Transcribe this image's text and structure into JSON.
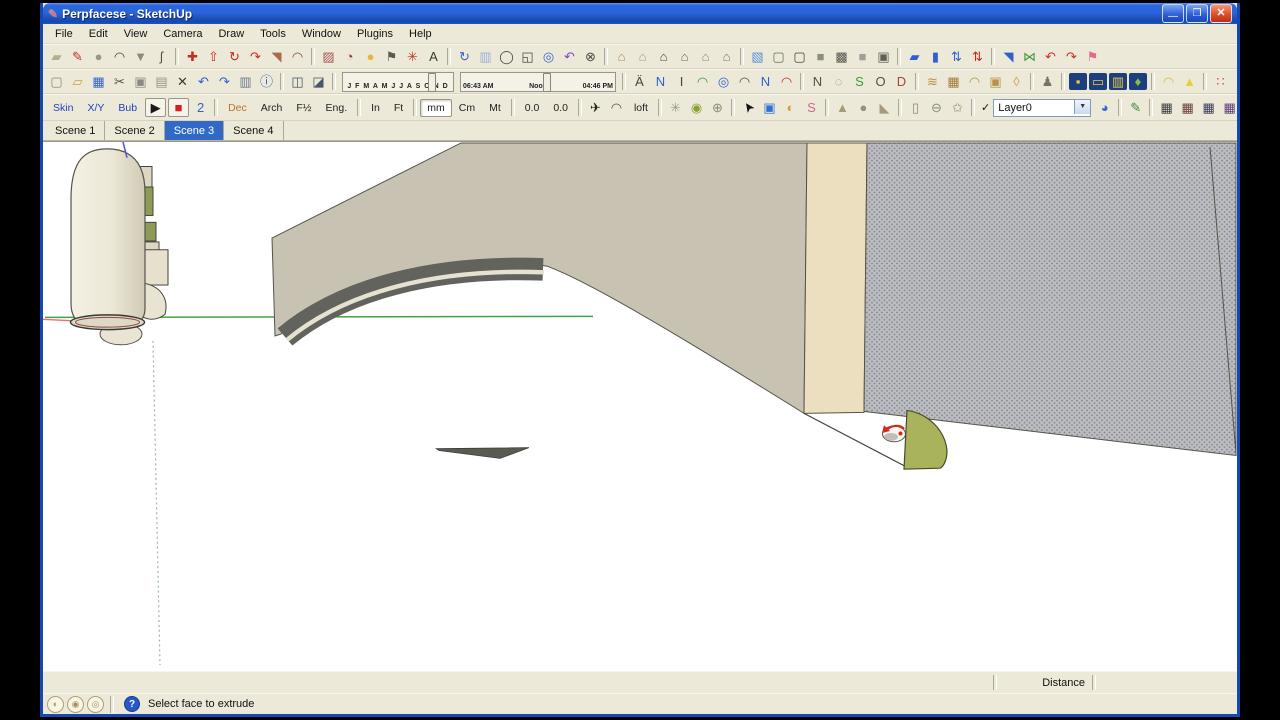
{
  "window": {
    "title": "Perpfacese - SketchUp",
    "icon_glyph": "✎",
    "glyph_min": "—",
    "glyph_restore": "❒",
    "glyph_close": "✕"
  },
  "menu": {
    "items": [
      "File",
      "Edit",
      "View",
      "Camera",
      "Draw",
      "Tools",
      "Window",
      "Plugins",
      "Help"
    ]
  },
  "colors": {
    "titlebar_blue": "#2b63d8",
    "toolbar_bg": "#ece9d8",
    "active_tab_blue": "#316ac5",
    "model_taupe": "#c7c2b2",
    "model_dark_band": "#63635d",
    "wall_tan": "#ecdfc0",
    "wall_texture_bg": "#bcbdc1",
    "wall_texture_dot": "#83858f",
    "capsule_cream": "#efebdc",
    "panel_olive": "#8e9a55",
    "fan_green": "#a9b35c",
    "axis_green": "#44a244",
    "axis_red": "#e87272",
    "axis_blue": "#5050d8",
    "sliver_dark": "#5a5a52",
    "viewport_white": "#ffffff"
  },
  "toolbar_row1": {
    "items": [
      {
        "t": "i",
        "n": "rectangle-tool",
        "g": "▰",
        "c": "#b5ad92"
      },
      {
        "t": "i",
        "n": "line-tool",
        "g": "✎",
        "c": "#c23125"
      },
      {
        "t": "i",
        "n": "circle-tool",
        "g": "●",
        "c": "#9b9685"
      },
      {
        "t": "i",
        "n": "arc-tool",
        "g": "◠",
        "c": "#4a4a44"
      },
      {
        "t": "i",
        "n": "polygon-tool",
        "g": "▼",
        "c": "#8f8a78"
      },
      {
        "t": "i",
        "n": "freehand-tool",
        "g": "ʃ",
        "c": "#55504a"
      },
      {
        "t": "s"
      },
      {
        "t": "i",
        "n": "move-tool",
        "g": "✚",
        "c": "#c8281e"
      },
      {
        "t": "i",
        "n": "pushpull-tool",
        "g": "⇧",
        "c": "#c8281e"
      },
      {
        "t": "i",
        "n": "rotate-tool",
        "g": "↻",
        "c": "#c8281e"
      },
      {
        "t": "i",
        "n": "followme-tool",
        "g": "↷",
        "c": "#c8281e"
      },
      {
        "t": "i",
        "n": "scale-tool",
        "g": "◥",
        "c": "#a86a48"
      },
      {
        "t": "i",
        "n": "offset-tool",
        "g": "◠",
        "c": "#8a4a3a"
      },
      {
        "t": "s"
      },
      {
        "t": "i",
        "n": "tape-measure-tool",
        "g": "▨",
        "c": "#a85858"
      },
      {
        "t": "i",
        "n": "protractor-tool",
        "g": "◔",
        "c": "#8a3a30"
      },
      {
        "t": "i",
        "n": "paint-bucket-tool",
        "g": "●",
        "c": "#e2b93a"
      },
      {
        "t": "i",
        "n": "text-tool",
        "g": "⚑",
        "c": "#5a5a52"
      },
      {
        "t": "i",
        "n": "axes-tool",
        "g": "✳",
        "c": "#c23125"
      },
      {
        "t": "i",
        "n": "3d-text-tool",
        "g": "A",
        "c": "#3a3a34"
      },
      {
        "t": "s"
      },
      {
        "t": "i",
        "n": "orbit-tool",
        "g": "↻",
        "c": "#3565cf"
      },
      {
        "t": "i",
        "n": "pan-tool",
        "g": "▥",
        "c": "#9bb0d8"
      },
      {
        "t": "i",
        "n": "zoom-tool",
        "g": "◯",
        "c": "#4a4a44"
      },
      {
        "t": "i",
        "n": "zoom-window-tool",
        "g": "◱",
        "c": "#4a4a44"
      },
      {
        "t": "i",
        "n": "zoom-extents-tool",
        "g": "◎",
        "c": "#3565cf"
      },
      {
        "t": "i",
        "n": "zoom-previous-tool",
        "g": "↶",
        "c": "#7a4ac0"
      },
      {
        "t": "i",
        "n": "zoom-photo-tool",
        "g": "⊗",
        "c": "#4a4a44"
      },
      {
        "t": "s"
      },
      {
        "t": "i",
        "n": "view-iso",
        "g": "⌂",
        "c": "#b5884a"
      },
      {
        "t": "i",
        "n": "view-top",
        "g": "⌂",
        "c": "#a89a78"
      },
      {
        "t": "i",
        "n": "view-front",
        "g": "⌂",
        "c": "#4a4a44"
      },
      {
        "t": "i",
        "n": "view-back",
        "g": "⌂",
        "c": "#6a6a60"
      },
      {
        "t": "i",
        "n": "view-left",
        "g": "⌂",
        "c": "#8a8a80"
      },
      {
        "t": "i",
        "n": "view-right",
        "g": "⌂",
        "c": "#7a7a70"
      },
      {
        "t": "s"
      },
      {
        "t": "i",
        "n": "style-xray",
        "g": "▧",
        "c": "#5a93d8"
      },
      {
        "t": "i",
        "n": "style-wireframe",
        "g": "▢",
        "c": "#6a6a60"
      },
      {
        "t": "i",
        "n": "style-hidden-line",
        "g": "▢",
        "c": "#44443e"
      },
      {
        "t": "i",
        "n": "style-shaded",
        "g": "■",
        "c": "#8c8c80"
      },
      {
        "t": "i",
        "n": "style-textured",
        "g": "▩",
        "c": "#55554e"
      },
      {
        "t": "i",
        "n": "style-monochrome",
        "g": "■",
        "c": "#a0a098"
      },
      {
        "t": "i",
        "n": "style-back-edges",
        "g": "▣",
        "c": "#5f5f58"
      },
      {
        "t": "s"
      },
      {
        "t": "i",
        "n": "perp-face-tool-1",
        "g": "▰",
        "c": "#2f5fd0"
      },
      {
        "t": "i",
        "n": "perp-face-tool-2",
        "g": "▮",
        "c": "#2f5fd0"
      },
      {
        "t": "i",
        "n": "perp-updown-tool-1",
        "g": "⇅",
        "c": "#2f5fd0"
      },
      {
        "t": "i",
        "n": "perp-updown-tool-2",
        "g": "⇅",
        "c": "#c8281e"
      },
      {
        "t": "s"
      },
      {
        "t": "i",
        "n": "diagonal-tool",
        "g": "◥",
        "c": "#2f5fd0"
      },
      {
        "t": "i",
        "n": "section-x-tool",
        "g": "⋈",
        "c": "#3a9a3a"
      },
      {
        "t": "i",
        "n": "curve-undo-tool",
        "g": "↶",
        "c": "#c23125"
      },
      {
        "t": "i",
        "n": "curve-redo-tool",
        "g": "↷",
        "c": "#c23125"
      },
      {
        "t": "i",
        "n": "flag-tool",
        "g": "⚑",
        "c": "#e06a8a"
      }
    ]
  },
  "toolbar_row2": {
    "items": [
      {
        "t": "i",
        "n": "new-file",
        "g": "▢",
        "c": "#8a8a80"
      },
      {
        "t": "i",
        "n": "open-file",
        "g": "▱",
        "c": "#c8a14a"
      },
      {
        "t": "i",
        "n": "save-file",
        "g": "▦",
        "c": "#2f5fd0"
      },
      {
        "t": "i",
        "n": "cut",
        "g": "✂",
        "c": "#55504a"
      },
      {
        "t": "i",
        "n": "copy",
        "g": "▣",
        "c": "#8a8a80"
      },
      {
        "t": "i",
        "n": "paste",
        "g": "▤",
        "c": "#9a9284"
      },
      {
        "t": "i",
        "n": "erase",
        "g": "✕",
        "c": "#3a3a34"
      },
      {
        "t": "i",
        "n": "undo",
        "g": "↶",
        "c": "#2f5fd0"
      },
      {
        "t": "i",
        "n": "redo",
        "g": "↷",
        "c": "#2f5fd0"
      },
      {
        "t": "i",
        "n": "print",
        "g": "▥",
        "c": "#6a7a8a"
      },
      {
        "t": "i",
        "n": "model-info",
        "g": "ⓘ",
        "c": "#2858c8"
      },
      {
        "t": "s"
      },
      {
        "t": "i",
        "n": "make-component",
        "g": "◫",
        "c": "#4a5568"
      },
      {
        "t": "i",
        "n": "component-cube",
        "g": "◪",
        "c": "#4a5568"
      },
      {
        "t": "s"
      },
      {
        "t": "months"
      },
      {
        "t": "time"
      },
      {
        "t": "s"
      },
      {
        "t": "i",
        "n": "bezier-curve-tool",
        "g": "Ä",
        "c": "#44443e"
      },
      {
        "t": "i",
        "n": "curve-n-tool",
        "g": "N",
        "c": "#2f5fd0"
      },
      {
        "t": "i",
        "n": "curve-i-tool",
        "g": "I",
        "c": "#44443e"
      },
      {
        "t": "i",
        "n": "arc-green-tool",
        "g": "◠",
        "c": "#3a9a3a"
      },
      {
        "t": "i",
        "n": "spiral-tool",
        "g": "◎",
        "c": "#2f5fd0"
      },
      {
        "t": "i",
        "n": "arc-dark-tool",
        "g": "◠",
        "c": "#55504a"
      },
      {
        "t": "i",
        "n": "curve-n2-tool",
        "g": "N",
        "c": "#2f5fd0"
      },
      {
        "t": "i",
        "n": "arc-red-tool",
        "g": "◠",
        "c": "#c23125"
      },
      {
        "t": "s"
      },
      {
        "t": "i",
        "n": "polyline-tool",
        "g": "N",
        "c": "#55504a"
      },
      {
        "t": "i",
        "n": "dashed-circle-tool",
        "g": "◌",
        "c": "#8a8a80"
      },
      {
        "t": "i",
        "n": "wrench-tool",
        "g": "S",
        "c": "#3a9a3a"
      },
      {
        "t": "i",
        "n": "circle-o-tool",
        "g": "O",
        "c": "#55504a"
      },
      {
        "t": "i",
        "n": "d-shape-tool",
        "g": "D",
        "c": "#a04a3a"
      },
      {
        "t": "s"
      },
      {
        "t": "i",
        "n": "sandbox-from-contours",
        "g": "≋",
        "c": "#b8914a"
      },
      {
        "t": "i",
        "n": "sandbox-from-scratch",
        "g": "▦",
        "c": "#a07a3a"
      },
      {
        "t": "i",
        "n": "smoove-tool",
        "g": "◠",
        "c": "#b8914a"
      },
      {
        "t": "i",
        "n": "stamp-tool",
        "g": "▣",
        "c": "#b8914a"
      },
      {
        "t": "i",
        "n": "drape-tool",
        "g": "◊",
        "c": "#c8a14a"
      },
      {
        "t": "s"
      },
      {
        "t": "i",
        "n": "person-figure",
        "g": "♟",
        "c": "#7a7468"
      },
      {
        "t": "s"
      },
      {
        "t": "i",
        "n": "film-stage-1",
        "g": "▪",
        "c": "#f0c83a",
        "bg": "#1d3f7e"
      },
      {
        "t": "i",
        "n": "film-stage-2",
        "g": "▭",
        "c": "#f0c83a",
        "bg": "#1d3f7e"
      },
      {
        "t": "i",
        "n": "film-stage-3",
        "g": "▥",
        "c": "#f0c83a",
        "bg": "#1d3f7e"
      },
      {
        "t": "i",
        "n": "film-stage-4",
        "g": "♦",
        "c": "#8ac040",
        "bg": "#1d3f7e"
      },
      {
        "t": "s"
      },
      {
        "t": "i",
        "n": "dome-tool",
        "g": "◠",
        "c": "#e2b93a"
      },
      {
        "t": "i",
        "n": "cone-tool",
        "g": "▲",
        "c": "#e2d23a"
      },
      {
        "t": "s"
      },
      {
        "t": "i",
        "n": "palette-dots-1",
        "g": "∷",
        "c": "#c04a8a"
      },
      {
        "t": "i",
        "n": "palette-dots-2",
        "g": "∷",
        "c": "#3a9ac0"
      }
    ]
  },
  "shadows": {
    "months_labels": "J F M A M J J A S O N D",
    "months_thumb_pct": 77,
    "time_start": "06:43 AM",
    "time_noon": "Noon",
    "time_end": "04:46 PM",
    "time_thumb_pct": 53
  },
  "toolbar_row3": {
    "items": [
      {
        "t": "b",
        "n": "skin-tool",
        "l": "Skin",
        "c": "#2040c0"
      },
      {
        "t": "b",
        "n": "xy-tool",
        "l": "X/Y",
        "c": "#2040c0"
      },
      {
        "t": "b",
        "n": "bubble-tool",
        "l": "Bub",
        "c": "#2040c0"
      },
      {
        "t": "i",
        "n": "play-button",
        "g": "▶",
        "c": "#1a1a1a",
        "box": true
      },
      {
        "t": "i",
        "n": "record-stop-button",
        "g": "■",
        "c": "#d42020",
        "box": true
      },
      {
        "t": "i",
        "n": "curl-tool",
        "g": "2",
        "c": "#2f5fd0"
      },
      {
        "t": "s"
      },
      {
        "t": "b",
        "n": "format-decimal-button",
        "l": "Dec",
        "c": "#b8742a"
      },
      {
        "t": "b",
        "n": "format-architectural-button",
        "l": "Arch"
      },
      {
        "t": "b",
        "n": "format-fractional-button",
        "l": "F½"
      },
      {
        "t": "b",
        "n": "format-engineering-button",
        "l": "Eng."
      },
      {
        "t": "s"
      },
      {
        "t": "b",
        "n": "unit-inches-button",
        "l": "In"
      },
      {
        "t": "b",
        "n": "unit-feet-button",
        "l": "Ft"
      },
      {
        "t": "s"
      },
      {
        "t": "b",
        "n": "unit-mm-button",
        "l": "mm",
        "p": true
      },
      {
        "t": "b",
        "n": "unit-cm-button",
        "l": "Cm"
      },
      {
        "t": "b",
        "n": "unit-meters-button",
        "l": "Mt"
      },
      {
        "t": "s"
      },
      {
        "t": "b",
        "n": "precision-decrease-button",
        "l": "0.0"
      },
      {
        "t": "b",
        "n": "precision-increase-button",
        "l": "0.0"
      },
      {
        "t": "s"
      },
      {
        "t": "i",
        "n": "plane-tool",
        "g": "✈",
        "c": "#22221e"
      },
      {
        "t": "i",
        "n": "flatten-arc-tool",
        "g": "◠",
        "c": "#55504a"
      },
      {
        "t": "b",
        "n": "loft-button",
        "l": "loft"
      },
      {
        "t": "s"
      },
      {
        "t": "i",
        "n": "shell-web-tool",
        "g": "✳",
        "c": "#9a9a92"
      },
      {
        "t": "i",
        "n": "lock-tool",
        "g": "◉",
        "c": "#8aa030"
      },
      {
        "t": "i",
        "n": "wire-sphere-tool",
        "g": "⊕",
        "c": "#8a8a80"
      },
      {
        "t": "s"
      },
      {
        "t": "i",
        "n": "select-cursor-tool",
        "g": "➤",
        "c": "#111111",
        "r": "rot-nw"
      },
      {
        "t": "i",
        "n": "soap-skin-tool",
        "g": "▣",
        "c": "#3070d0"
      },
      {
        "t": "i",
        "n": "bubble-grab-tool",
        "g": "◐",
        "c": "#d0a030"
      },
      {
        "t": "i",
        "n": "worm-tool",
        "g": "S",
        "c": "#d06a8a"
      },
      {
        "t": "s"
      },
      {
        "t": "i",
        "n": "tan-cone-tool",
        "g": "▲",
        "c": "#a89a78"
      },
      {
        "t": "i",
        "n": "tan-sphere-tool",
        "g": "●",
        "c": "#9a9078"
      },
      {
        "t": "i",
        "n": "tan-wedge-tool",
        "g": "◣",
        "c": "#a89a78"
      },
      {
        "t": "s"
      },
      {
        "t": "i",
        "n": "extrude-door-tool",
        "g": "▯",
        "c": "#8a8a80"
      },
      {
        "t": "i",
        "n": "extrude-lens-tool",
        "g": "⊖",
        "c": "#8a8a80"
      },
      {
        "t": "i",
        "n": "extrude-star-tool",
        "g": "✩",
        "c": "#8a8a80"
      },
      {
        "t": "s"
      },
      {
        "t": "layer",
        "chk": "✓",
        "dd": "▼"
      },
      {
        "t": "i",
        "n": "layer-manager",
        "g": "◕",
        "c": "#3565cf"
      },
      {
        "t": "s"
      },
      {
        "t": "i",
        "n": "sketchy-pencil-tool",
        "g": "✎",
        "c": "#3a8a3a"
      },
      {
        "t": "s"
      },
      {
        "t": "i",
        "n": "extrude-edges-by-rails",
        "g": "▦",
        "c": "#3a3a3a"
      },
      {
        "t": "i",
        "n": "extrude-edges-by-vector",
        "g": "▦",
        "c": "#6a3a3a"
      },
      {
        "t": "i",
        "n": "extrude-edges-by-vector-to-object",
        "g": "▦",
        "c": "#3a3a5a"
      },
      {
        "t": "i",
        "n": "extrude-edges-by-lathe",
        "g": "▦",
        "c": "#5a3a7a"
      },
      {
        "t": "i",
        "n": "extrude-edges-by-loft",
        "g": "▦",
        "c": "#7a5a3a"
      },
      {
        "t": "i",
        "n": "extrude-edges-by-face",
        "g": "▦",
        "c": "#44443e"
      },
      {
        "t": "i",
        "n": "extrude-edges-by-offset",
        "g": "▦",
        "c": "#3a5a3a"
      },
      {
        "t": "i",
        "n": "extrude-edges-to-lattice",
        "g": "▦",
        "c": "#6a4a4a"
      }
    ]
  },
  "layers": {
    "selected": "Layer0"
  },
  "scene_tabs": {
    "tabs": [
      {
        "label": "Scene 1",
        "active": false
      },
      {
        "label": "Scene 2",
        "active": false
      },
      {
        "label": "Scene 3",
        "active": true
      },
      {
        "label": "Scene 4",
        "active": false
      }
    ]
  },
  "vcb": {
    "label": "Distance",
    "value": ""
  },
  "status": {
    "icons": [
      {
        "n": "geolocation-icon",
        "g": "◐"
      },
      {
        "n": "claim-model-icon",
        "g": "◉"
      },
      {
        "n": "credits-icon",
        "g": "◎"
      }
    ],
    "help_icon": "?",
    "help_text": "Select face to extrude"
  }
}
